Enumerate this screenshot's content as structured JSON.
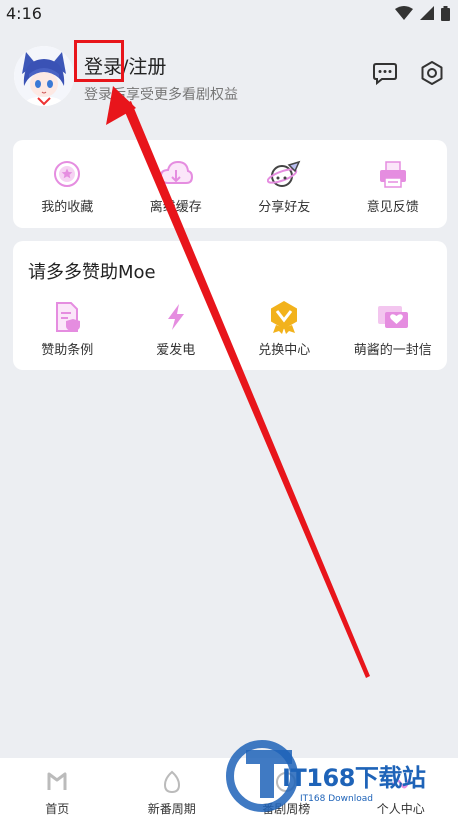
{
  "status_bar": {
    "time": "4:16"
  },
  "header": {
    "login_title": "登录/注册",
    "login_subtitle": "登录后享受更多看剧权益"
  },
  "shortcuts": [
    {
      "label": "我的收藏",
      "icon": "star-icon"
    },
    {
      "label": "离线缓存",
      "icon": "cloud-download-icon"
    },
    {
      "label": "分享好友",
      "icon": "share-planet-icon"
    },
    {
      "label": "意见反馈",
      "icon": "printer-feedback-icon"
    }
  ],
  "sponsor": {
    "title": "请多多赞助Moe",
    "items": [
      {
        "label": "赞助条例",
        "icon": "document-shield-icon"
      },
      {
        "label": "爱发电",
        "icon": "lightning-icon"
      },
      {
        "label": "兑换中心",
        "icon": "medal-icon"
      },
      {
        "label": "萌酱的一封信",
        "icon": "letter-heart-icon"
      }
    ]
  },
  "tabbar": [
    {
      "label": "首页",
      "icon": "home-icon"
    },
    {
      "label": "新番周期",
      "icon": "egg-icon"
    },
    {
      "label": "番剧周榜",
      "icon": "ranking-icon"
    },
    {
      "label": "个人中心",
      "icon": "profile-icon"
    }
  ],
  "watermark": {
    "brand": "IT168下载站",
    "sub": "IT168 Download"
  },
  "colors": {
    "accent_pink": "#e58de0",
    "highlight_red": "#e8151b",
    "medal_gold": "#f2b21c"
  }
}
